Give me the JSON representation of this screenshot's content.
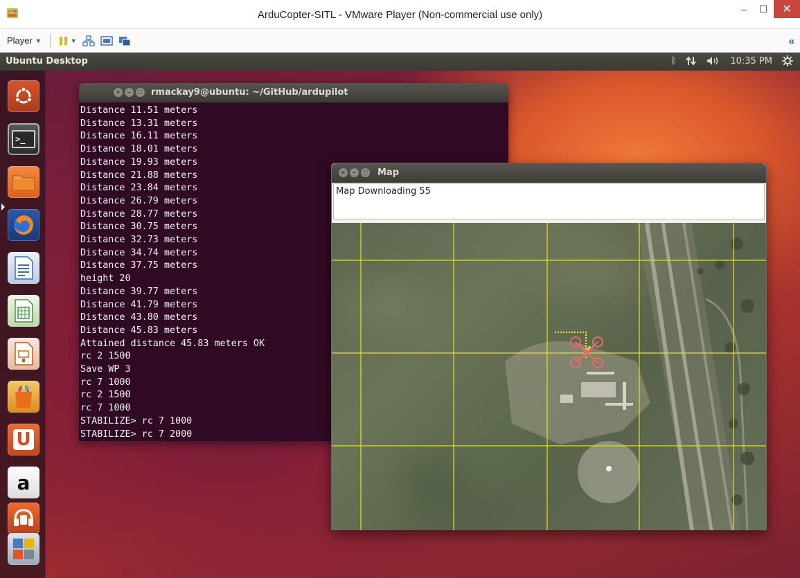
{
  "vmware": {
    "title": "ArduCopter-SITL - VMware Player (Non-commercial use only)",
    "window_buttons": {
      "minimize": "–",
      "maximize": "☐",
      "close": "✕"
    },
    "toolbar": {
      "player_label": "Player",
      "collapse_label": "«"
    }
  },
  "ubuntu_panel": {
    "title": "Ubuntu Desktop",
    "time": "10:35 PM",
    "indicators": [
      "bluetooth-icon",
      "network-icon",
      "volume-icon",
      "session-gear-icon"
    ]
  },
  "launcher": {
    "items": [
      {
        "name": "dash-home",
        "icon": "ubuntu-logo-icon"
      },
      {
        "name": "terminal",
        "icon": "terminal-icon",
        "label": ">_"
      },
      {
        "name": "files",
        "icon": "folder-icon"
      },
      {
        "name": "firefox",
        "icon": "firefox-icon"
      },
      {
        "name": "libreoffice-writer",
        "icon": "writer-icon"
      },
      {
        "name": "libreoffice-calc",
        "icon": "calc-icon"
      },
      {
        "name": "libreoffice-impress",
        "icon": "impress-icon"
      },
      {
        "name": "software-center",
        "icon": "shopping-bag-icon"
      },
      {
        "name": "ubuntu-one",
        "icon": "ubuntu-one-icon",
        "label": "U"
      },
      {
        "name": "amazon",
        "icon": "amazon-icon",
        "label": "a"
      },
      {
        "name": "ubuntu-one-music",
        "icon": "ubuntu-one-music-icon"
      },
      {
        "name": "workspaces",
        "icon": "workspace-switcher-icon"
      }
    ]
  },
  "terminal": {
    "title": "rmackay9@ubuntu: ~/GitHub/ardupilot",
    "lines": [
      "Distance 11.51 meters",
      "Distance 13.31 meters",
      "Distance 16.11 meters",
      "Distance 18.01 meters",
      "Distance 19.93 meters",
      "Distance 21.88 meters",
      "Distance 23.84 meters",
      "Distance 26.79 meters",
      "Distance 28.77 meters",
      "Distance 30.75 meters",
      "Distance 32.73 meters",
      "Distance 34.74 meters",
      "Distance 37.75 meters",
      "height 20",
      "Distance 39.77 meters",
      "Distance 41.79 meters",
      "Distance 43.80 meters",
      "Distance 45.83 meters",
      "Attained distance 45.83 meters OK",
      "rc 2 1500",
      "Save WP 3",
      "rc 7 1000",
      "rc 2 1500",
      "rc 7 1000",
      "STABILIZE> rc 7 1000",
      "STABILIZE> rc 7 2000"
    ]
  },
  "map": {
    "title": "Map",
    "status_text": "Map Downloading 55",
    "grid_color": "#e8e21c",
    "track_color": "#f2e52a",
    "vehicle_color": "#f06a6a"
  }
}
